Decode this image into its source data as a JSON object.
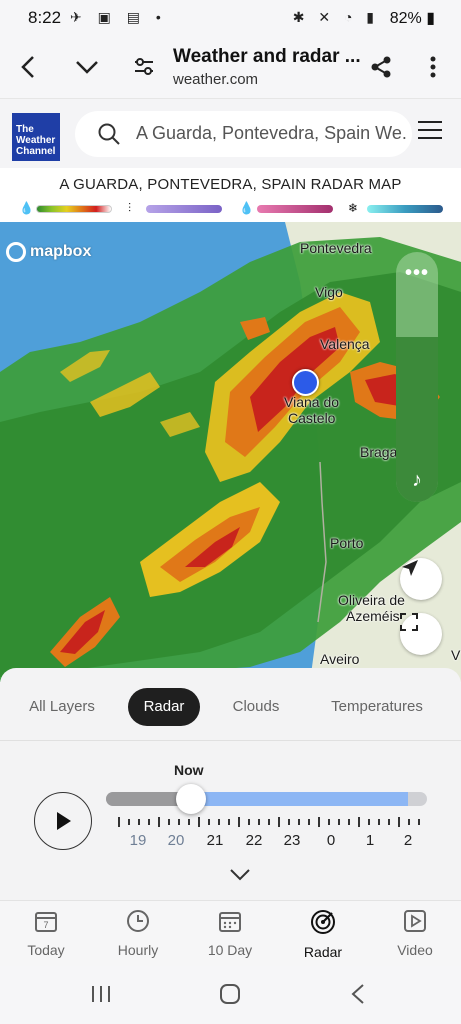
{
  "status_bar": {
    "time": "8:22",
    "battery": "82%"
  },
  "browser": {
    "title": "Weather and radar ...",
    "url": "weather.com"
  },
  "site": {
    "logo_lines": [
      "The",
      "Weather",
      "Channel"
    ],
    "search_value": "A Guarda, Pontevedra, Spain We..."
  },
  "radar": {
    "title": "A GUARDA, PONTEVEDRA, SPAIN RADAR MAP",
    "legend": [
      {
        "icon": "rain-drop-icon",
        "colors": [
          "#2e8b2e",
          "#e5d020",
          "#d21e1e",
          "#ffffff"
        ]
      },
      {
        "icon": "mix-icon",
        "colors": [
          "#a186d8",
          "#7a62c6"
        ]
      },
      {
        "icon": "ice-drop-icon",
        "colors": [
          "#e0609a",
          "#a3306e"
        ]
      },
      {
        "icon": "snowflake-icon",
        "colors": [
          "#6fe0e0",
          "#2c5a8c"
        ]
      }
    ]
  },
  "map": {
    "attribution": "mapbox",
    "labels": {
      "pontevedra": "Pontevedra",
      "vigo": "Vigo",
      "valenca": "Valença",
      "viana1": "Viana do",
      "viana2": "Castelo",
      "braga": "Braga",
      "porto": "Porto",
      "oliveira1": "Oliveira de",
      "oliveira2": "Azeméis",
      "aveiro": "Aveiro",
      "edge": "V"
    },
    "opacity_level": 0.66
  },
  "layers": {
    "tabs": [
      "All Layers",
      "Radar",
      "Clouds",
      "Temperatures"
    ],
    "active": "Radar"
  },
  "timeline": {
    "now_label": "Now",
    "hours": [
      "19",
      "20",
      "21",
      "22",
      "23",
      "0",
      "1",
      "2"
    ],
    "position": 0.26
  },
  "bottom_nav": [
    {
      "label": "Today",
      "icon": "calendar-7-icon",
      "badge": "7"
    },
    {
      "label": "Hourly",
      "icon": "clock-icon"
    },
    {
      "label": "10 Day",
      "icon": "calendar-grid-icon"
    },
    {
      "label": "Radar",
      "icon": "radar-icon",
      "active": true
    },
    {
      "label": "Video",
      "icon": "video-play-icon"
    }
  ]
}
